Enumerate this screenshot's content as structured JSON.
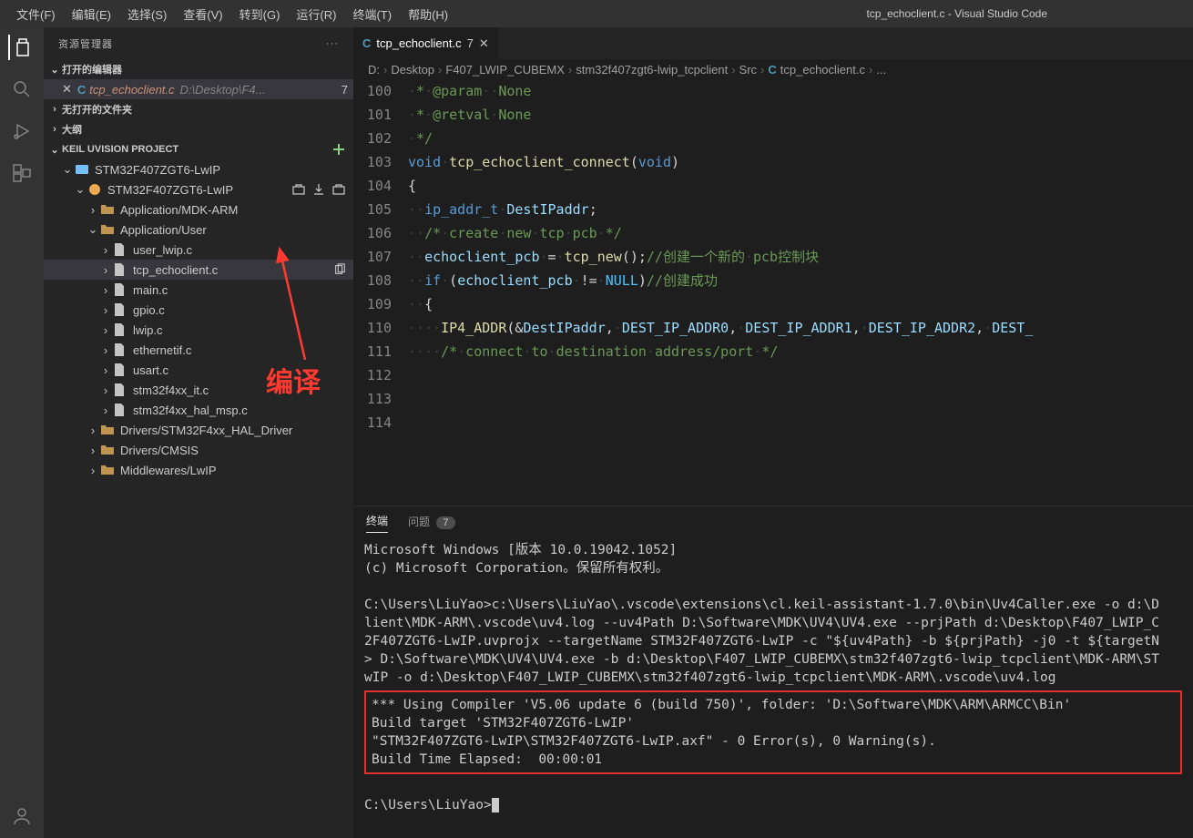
{
  "window": {
    "title": "tcp_echoclient.c - Visual Studio Code"
  },
  "menu": [
    "文件(F)",
    "编辑(E)",
    "选择(S)",
    "查看(V)",
    "转到(G)",
    "运行(R)",
    "终端(T)",
    "帮助(H)"
  ],
  "explorer": {
    "title": "资源管理器",
    "sections": {
      "openEditors": "打开的编辑器",
      "noOpenFolder": "无打开的文件夹",
      "outline": "大纲",
      "keil": "KEIL UVISION PROJECT"
    },
    "openFile": {
      "name": "tcp_echoclient.c",
      "path": "D:\\Desktop\\F4...",
      "mod": "7",
      "langIcon": "C"
    },
    "project": {
      "root": "STM32F407ZGT6-LwIP",
      "target": "STM32F407ZGT6-LwIP",
      "groups": [
        {
          "name": "Application/MDK-ARM",
          "open": false
        },
        {
          "name": "Application/User",
          "open": true,
          "files": [
            "user_lwip.c",
            "tcp_echoclient.c",
            "main.c",
            "gpio.c",
            "lwip.c",
            "ethernetif.c",
            "usart.c",
            "stm32f4xx_it.c",
            "stm32f4xx_hal_msp.c"
          ]
        },
        {
          "name": "Drivers/STM32F4xx_HAL_Driver",
          "open": false
        },
        {
          "name": "Drivers/CMSIS",
          "open": false
        },
        {
          "name": "Middlewares/LwIP",
          "open": false
        }
      ]
    }
  },
  "editor": {
    "tab": {
      "lang": "C",
      "name": "tcp_echoclient.c",
      "mod": "7"
    },
    "breadcrumb": [
      "D:",
      "Desktop",
      "F407_LWIP_CUBEMX",
      "stm32f407zgt6-lwip_tcpclient",
      "Src",
      "tcp_echoclient.c",
      "..."
    ],
    "firstLine": 100,
    "lines": [
      " * @param  None",
      " * @retval None",
      " */",
      "void tcp_echoclient_connect(void)",
      "{",
      "  ip_addr_t DestIPaddr;",
      "",
      "  /* create new tcp pcb */",
      "  echoclient_pcb = tcp_new();//创建一个新的 pcb控制块",
      "",
      "  if (echoclient_pcb != NULL)//创建成功",
      "  {",
      "    IP4_ADDR(&DestIPaddr, DEST_IP_ADDR0, DEST_IP_ADDR1, DEST_IP_ADDR2, DEST_",
      "",
      "    /* connect to destination address/port */"
    ]
  },
  "panel": {
    "tabs": {
      "terminal": "终端",
      "problems": "问题",
      "probCount": "7"
    },
    "lines_pre": [
      "Microsoft Windows [版本 10.0.19042.1052]",
      "(c) Microsoft Corporation。保留所有权利。",
      "",
      "C:\\Users\\LiuYao>c:\\Users\\LiuYao\\.vscode\\extensions\\cl.keil-assistant-1.7.0\\bin\\Uv4Caller.exe -o d:\\D",
      "lient\\MDK-ARM\\.vscode\\uv4.log --uv4Path D:\\Software\\MDK\\UV4\\UV4.exe --prjPath d:\\Desktop\\F407_LWIP_C",
      "2F407ZGT6-LwIP.uvprojx --targetName STM32F407ZGT6-LwIP -c \"${uv4Path} -b ${prjPath} -j0 -t ${targetN",
      "> D:\\Software\\MDK\\UV4\\UV4.exe -b d:\\Desktop\\F407_LWIP_CUBEMX\\stm32f407zgt6-lwip_tcpclient\\MDK-ARM\\ST",
      "wIP -o d:\\Desktop\\F407_LWIP_CUBEMX\\stm32f407zgt6-lwip_tcpclient\\MDK-ARM\\.vscode\\uv4.log"
    ],
    "lines_box": [
      "*** Using Compiler 'V5.06 update 6 (build 750)', folder: 'D:\\Software\\MDK\\ARM\\ARMCC\\Bin'",
      "Build target 'STM32F407ZGT6-LwIP'",
      "\"STM32F407ZGT6-LwIP\\STM32F407ZGT6-LwIP.axf\" - 0 Error(s), 0 Warning(s).",
      "Build Time Elapsed:  00:00:01"
    ],
    "prompt": "C:\\Users\\LiuYao>"
  },
  "annotation": {
    "text": "编译"
  }
}
